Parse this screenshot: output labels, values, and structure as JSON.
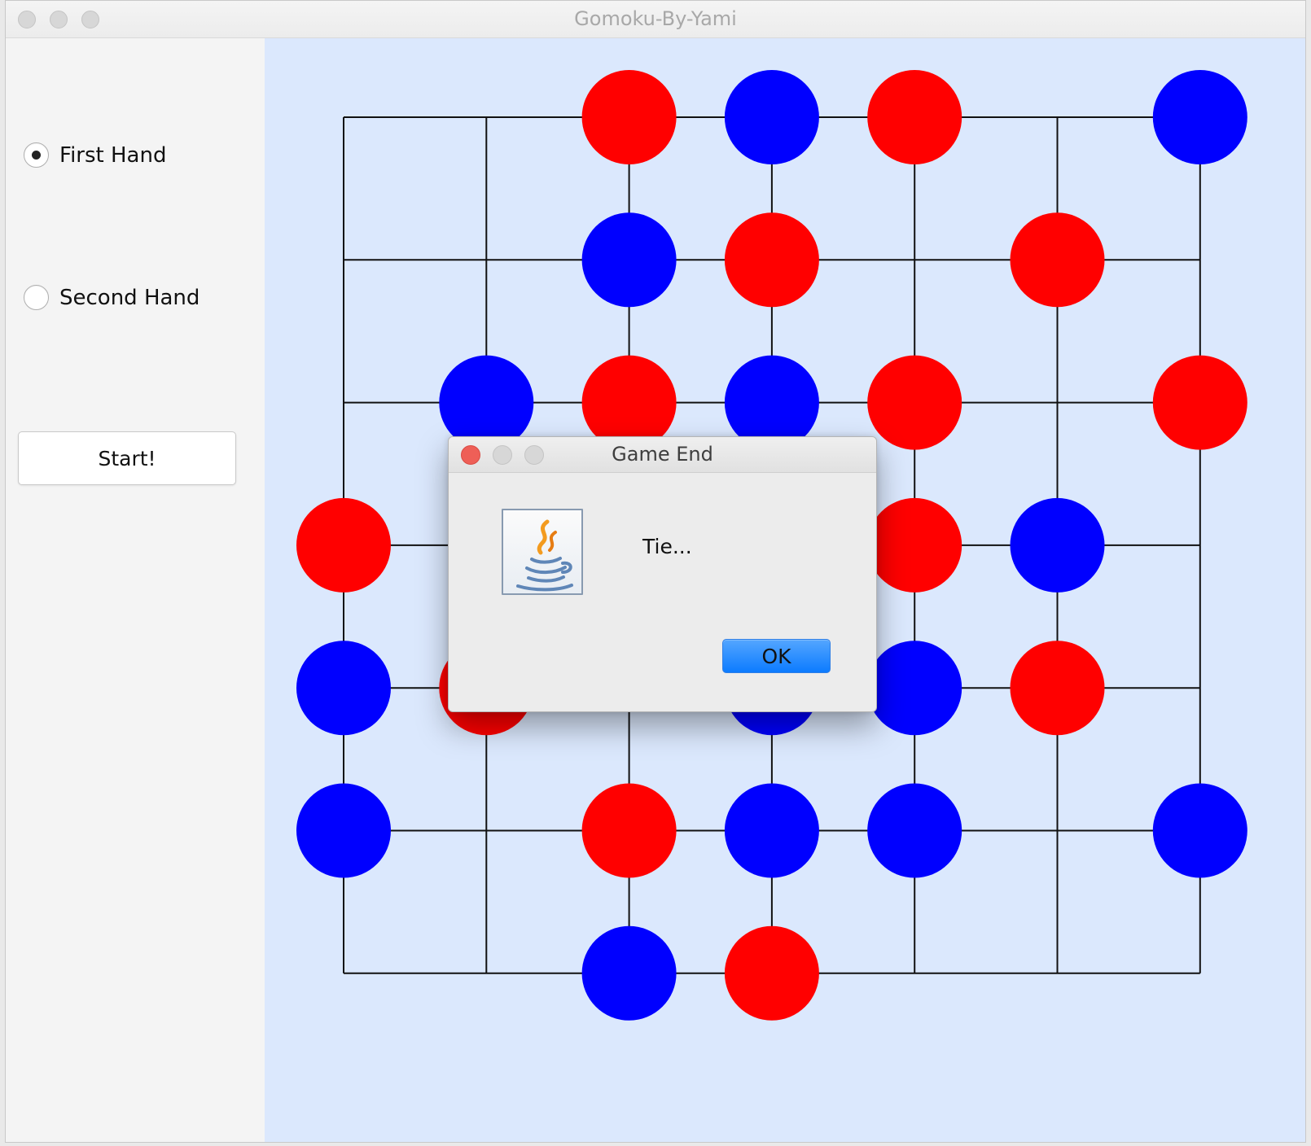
{
  "window": {
    "title": "Gomoku-By-Yami"
  },
  "sidebar": {
    "first_hand": {
      "label": "First Hand",
      "checked": true
    },
    "second_hand": {
      "label": "Second Hand",
      "checked": false
    },
    "start_label": "Start!"
  },
  "board": {
    "size": 7,
    "stones": [
      {
        "row": 0,
        "col": 2,
        "color": "red"
      },
      {
        "row": 0,
        "col": 3,
        "color": "blue"
      },
      {
        "row": 0,
        "col": 4,
        "color": "red"
      },
      {
        "row": 0,
        "col": 6,
        "color": "blue"
      },
      {
        "row": 1,
        "col": 2,
        "color": "blue"
      },
      {
        "row": 1,
        "col": 3,
        "color": "red"
      },
      {
        "row": 1,
        "col": 5,
        "color": "red"
      },
      {
        "row": 2,
        "col": 1,
        "color": "blue"
      },
      {
        "row": 2,
        "col": 2,
        "color": "red"
      },
      {
        "row": 2,
        "col": 3,
        "color": "blue"
      },
      {
        "row": 2,
        "col": 4,
        "color": "red"
      },
      {
        "row": 2,
        "col": 6,
        "color": "red"
      },
      {
        "row": 3,
        "col": 0,
        "color": "red"
      },
      {
        "row": 3,
        "col": 4,
        "color": "red"
      },
      {
        "row": 3,
        "col": 5,
        "color": "blue"
      },
      {
        "row": 4,
        "col": 0,
        "color": "blue"
      },
      {
        "row": 4,
        "col": 1,
        "color": "red"
      },
      {
        "row": 4,
        "col": 3,
        "color": "blue"
      },
      {
        "row": 4,
        "col": 4,
        "color": "blue"
      },
      {
        "row": 4,
        "col": 5,
        "color": "red"
      },
      {
        "row": 5,
        "col": 0,
        "color": "blue"
      },
      {
        "row": 5,
        "col": 2,
        "color": "red"
      },
      {
        "row": 5,
        "col": 3,
        "color": "blue"
      },
      {
        "row": 5,
        "col": 4,
        "color": "blue"
      },
      {
        "row": 5,
        "col": 6,
        "color": "blue"
      },
      {
        "row": 6,
        "col": 2,
        "color": "blue"
      },
      {
        "row": 6,
        "col": 3,
        "color": "red"
      }
    ],
    "colors": {
      "red": "#ff0000",
      "blue": "#0000ff",
      "grid": "#111111",
      "background": "#dbe8fd"
    }
  },
  "dialog": {
    "title": "Game End",
    "message": "Tie...",
    "ok_label": "OK",
    "icon": "java-icon"
  }
}
